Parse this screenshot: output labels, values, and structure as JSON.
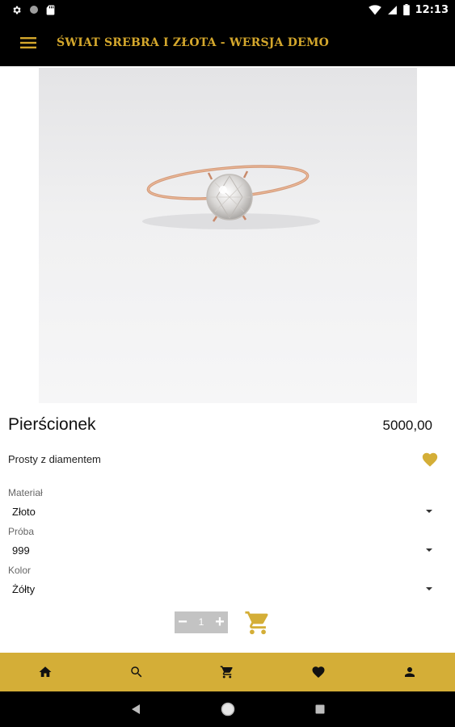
{
  "status_bar": {
    "time": "12:13",
    "left_icons": [
      "gear-icon",
      "circle-icon",
      "sd-card-icon"
    ],
    "right_icons": [
      "wifi-icon",
      "signal-icon",
      "battery-icon"
    ]
  },
  "app_bar": {
    "title": "ŚWIAT SREBRA I ZŁOTA - WERSJA DEMO",
    "menu_icon": "hamburger-icon",
    "title_color": "#d4a72c"
  },
  "product": {
    "name": "Pierścionek",
    "price": "5000,00",
    "description": "Prosty z diamentem",
    "favorite_icon": "heart-icon",
    "accent_color": "#d4ae37"
  },
  "options": [
    {
      "label": "Materiał",
      "value": "Złoto"
    },
    {
      "label": "Próba",
      "value": "999"
    },
    {
      "label": "Kolor",
      "value": "Żółty"
    }
  ],
  "quantity": {
    "value": "1",
    "decrement": "−",
    "increment": "+"
  },
  "bottom_nav": {
    "items": [
      "home-icon",
      "search-icon",
      "cart-icon",
      "heart-icon",
      "person-icon"
    ],
    "background": "#d4ae37"
  },
  "system_nav": {
    "items": [
      "back-icon",
      "home-circle-icon",
      "recents-icon"
    ]
  }
}
